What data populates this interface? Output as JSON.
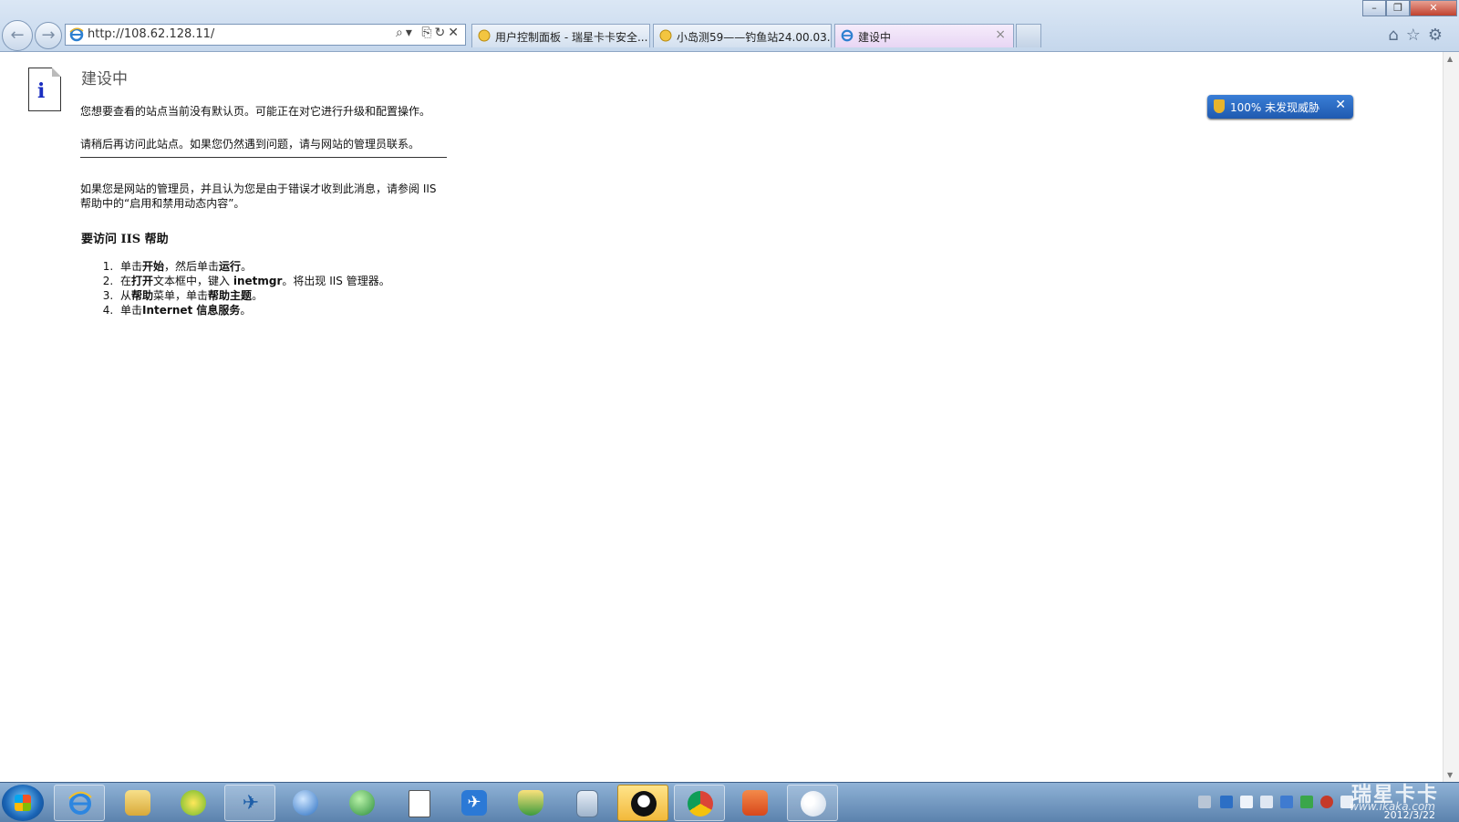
{
  "browser": {
    "url": "http://108.62.128.11/",
    "tabs": [
      {
        "label": "用户控制面板 - 瑞星卡卡安全..."
      },
      {
        "label": "小岛测59——钓鱼站24.00.03...."
      },
      {
        "label": "建设中",
        "close": "×"
      }
    ],
    "nav": {
      "back": "←",
      "forward": "→"
    },
    "address_tools": "⌕▾ ⎘↻✕",
    "window_buttons": {
      "minimize": "–",
      "restore": "❐",
      "close": "✕"
    },
    "right_icons": "⌂☆⚙"
  },
  "page": {
    "title": "建设中",
    "p1": "您想要查看的站点当前没有默认页。可能正在对它进行升级和配置操作。",
    "p2": "请稍后再访问此站点。如果您仍然遇到问题，请与网站的管理员联系。",
    "p3_line1": "如果您是网站的管理员，并且认为您是由于错误才收到此消息，请参阅 IIS",
    "p3_line2": "帮助中的“启用和禁用动态内容”。",
    "iis_heading": "要访问 IIS 帮助",
    "steps": [
      {
        "a": "单击",
        "b": "开始",
        "c": "，然后单击",
        "d": "运行",
        "e": "。"
      },
      {
        "a": "在",
        "b": "打开",
        "c": "文本框中，键入 ",
        "d": "inetmgr",
        "e": "。将出现 IIS 管理器。"
      },
      {
        "a": "从",
        "b": "帮助",
        "c": "菜单，单击",
        "d": "帮助主题",
        "e": "。"
      },
      {
        "a": "单击",
        "b": "Internet 信息服务",
        "c": "",
        "d": "",
        "e": "。"
      }
    ]
  },
  "security_popup": {
    "label": "100%  未发现威胁",
    "close": "✕"
  },
  "taskbar": {
    "watermark": "瑞星卡卡",
    "watermark_url": "www.ikaka.com",
    "date": "2012/3/22"
  },
  "colors": {
    "accent": "#1f5ab0",
    "info_icon": "#1a2ec0"
  }
}
